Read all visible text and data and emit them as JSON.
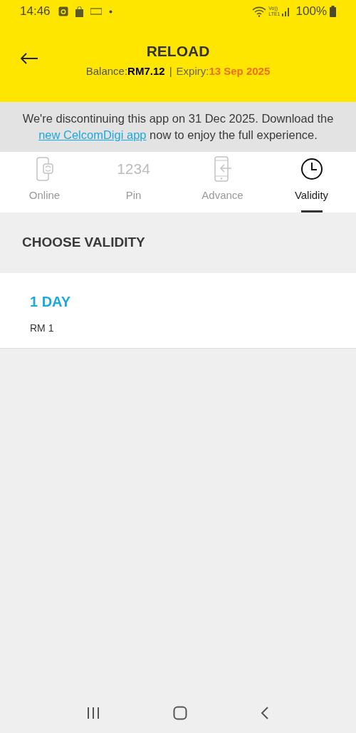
{
  "status_bar": {
    "time": "14:46",
    "volte": "Vo))",
    "lte": "LTE1",
    "battery": "100%"
  },
  "header": {
    "title": "RELOAD",
    "balance_label": "Balance:",
    "balance": "RM7.12",
    "separator": "|",
    "expiry_label": "Expiry:",
    "expiry": "13 Sep 2025"
  },
  "notice": {
    "text_before": "We're discontinuing this app on 31 Dec 2025. Download the",
    "link": "new CelcomDigi app",
    "text_after": "now to enjoy the full experience."
  },
  "tabs": [
    {
      "label": "Online",
      "kind": "phone-refresh",
      "selected": false
    },
    {
      "label": "Pin",
      "kind": "digits",
      "digits": "1234",
      "selected": false
    },
    {
      "label": "Advance",
      "kind": "phone-arrow",
      "selected": false
    },
    {
      "label": "Validity",
      "kind": "clock",
      "selected": true
    }
  ],
  "section_title": "CHOOSE VALIDITY",
  "options": [
    {
      "title": "1 DAY",
      "price": "RM 1"
    }
  ]
}
